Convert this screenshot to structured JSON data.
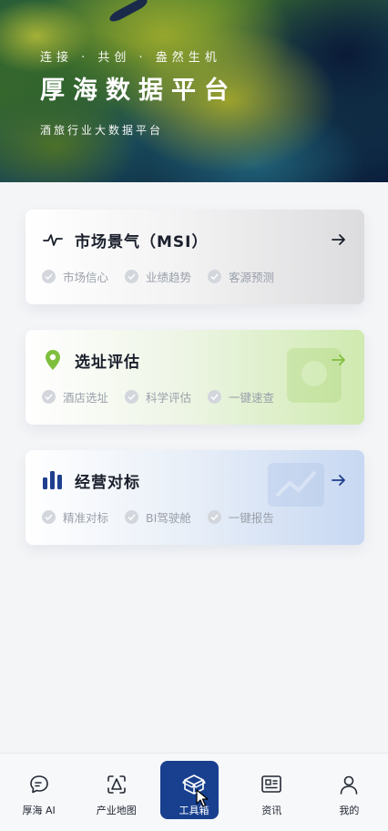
{
  "hero": {
    "slogan": "连接 · 共创 · 盎然生机",
    "title": "厚海数据平台",
    "subtitle": "酒旅行业大数据平台"
  },
  "cards": [
    {
      "title": "市场景气（MSI）",
      "icon": "pulse-icon",
      "tags": [
        "市场信心",
        "业绩趋势",
        "客源预测"
      ]
    },
    {
      "title": "选址评估",
      "icon": "location-pin-icon",
      "tags": [
        "酒店选址",
        "科学评估",
        "一键速查"
      ]
    },
    {
      "title": "经营对标",
      "icon": "bar-chart-icon",
      "tags": [
        "精准对标",
        "BI驾驶舱",
        "一键报告"
      ]
    }
  ],
  "tabbar": {
    "items": [
      {
        "label": "厚海 AI",
        "icon": "chat-ai-icon",
        "active": false
      },
      {
        "label": "产业地图",
        "icon": "map-scan-icon",
        "active": false
      },
      {
        "label": "工具箱",
        "icon": "toolbox-icon",
        "active": true
      },
      {
        "label": "资讯",
        "icon": "news-icon",
        "active": false
      },
      {
        "label": "我的",
        "icon": "profile-icon",
        "active": false
      }
    ]
  },
  "colors": {
    "accent": "#18408f",
    "pin_green": "#7fbf3e",
    "chart_blue": "#1f3f8f"
  }
}
